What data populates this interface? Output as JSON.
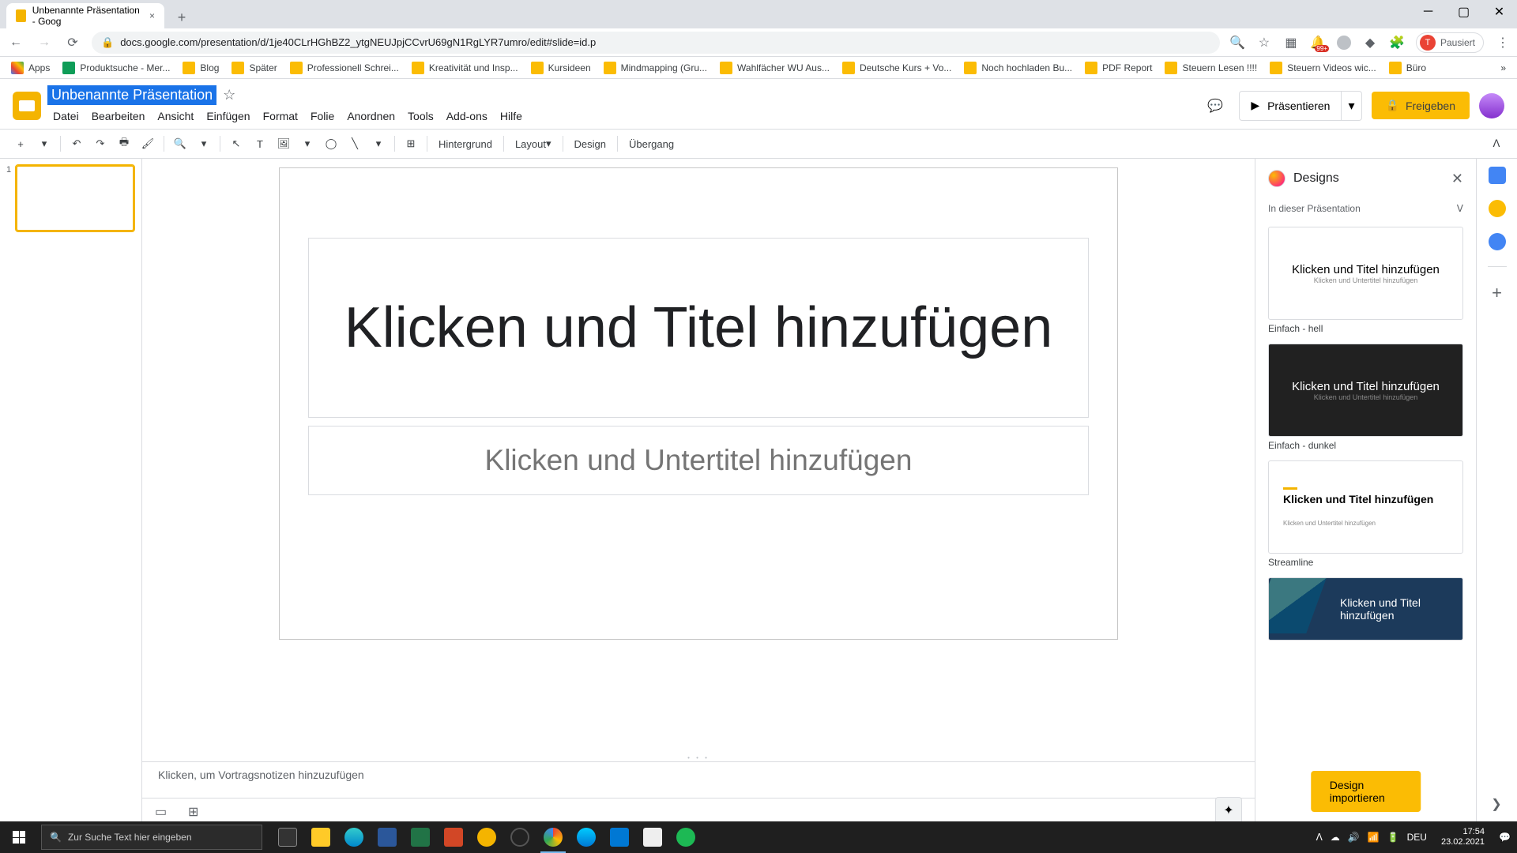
{
  "browser": {
    "tab_title": "Unbenannte Präsentation - Goog",
    "url": "docs.google.com/presentation/d/1je40CLrHGhBZ2_ytgNEUJpjCCvrU69gN1RgLYR7umro/edit#slide=id.p",
    "sync_label": "Pausiert",
    "ext_badge": "99+"
  },
  "bookmarks": [
    "Apps",
    "Produktsuche - Mer...",
    "Blog",
    "Später",
    "Professionell Schrei...",
    "Kreativität und Insp...",
    "Kursideen",
    "Mindmapping  (Gru...",
    "Wahlfächer WU Aus...",
    "Deutsche Kurs + Vo...",
    "Noch hochladen Bu...",
    "PDF Report",
    "Steuern Lesen !!!!",
    "Steuern Videos wic...",
    "Büro"
  ],
  "app": {
    "doc_title": "Unbenannte Präsentation",
    "menu": [
      "Datei",
      "Bearbeiten",
      "Ansicht",
      "Einfügen",
      "Format",
      "Folie",
      "Anordnen",
      "Tools",
      "Add-ons",
      "Hilfe"
    ],
    "present_label": "Präsentieren",
    "share_label": "Freigeben"
  },
  "toolbar": {
    "background": "Hintergrund",
    "layout": "Layout",
    "design": "Design",
    "transition": "Übergang"
  },
  "slide": {
    "number": "1",
    "title_placeholder": "Klicken und Titel hinzufügen",
    "subtitle_placeholder": "Klicken und Untertitel hinzufügen",
    "notes_placeholder": "Klicken, um Vortragsnotizen hinzuzufügen"
  },
  "designs": {
    "title": "Designs",
    "section": "In dieser Präsentation",
    "themes": [
      {
        "name": "Einfach - hell",
        "title": "Klicken und Titel hinzufügen",
        "sub": "Klicken und Untertitel hinzufügen"
      },
      {
        "name": "Einfach - dunkel",
        "title": "Klicken und Titel hinzufügen",
        "sub": "Klicken und Untertitel hinzufügen"
      },
      {
        "name": "Streamline",
        "title": "Klicken und Titel hinzufügen",
        "sub": "Klicken und Untertitel hinzufügen"
      }
    ],
    "focus_title": "Klicken und Titel hinzufügen",
    "import_label": "Design importieren"
  },
  "taskbar": {
    "search_placeholder": "Zur Suche Text hier eingeben",
    "lang": "DEU",
    "time": "17:54",
    "date": "23.02.2021"
  }
}
